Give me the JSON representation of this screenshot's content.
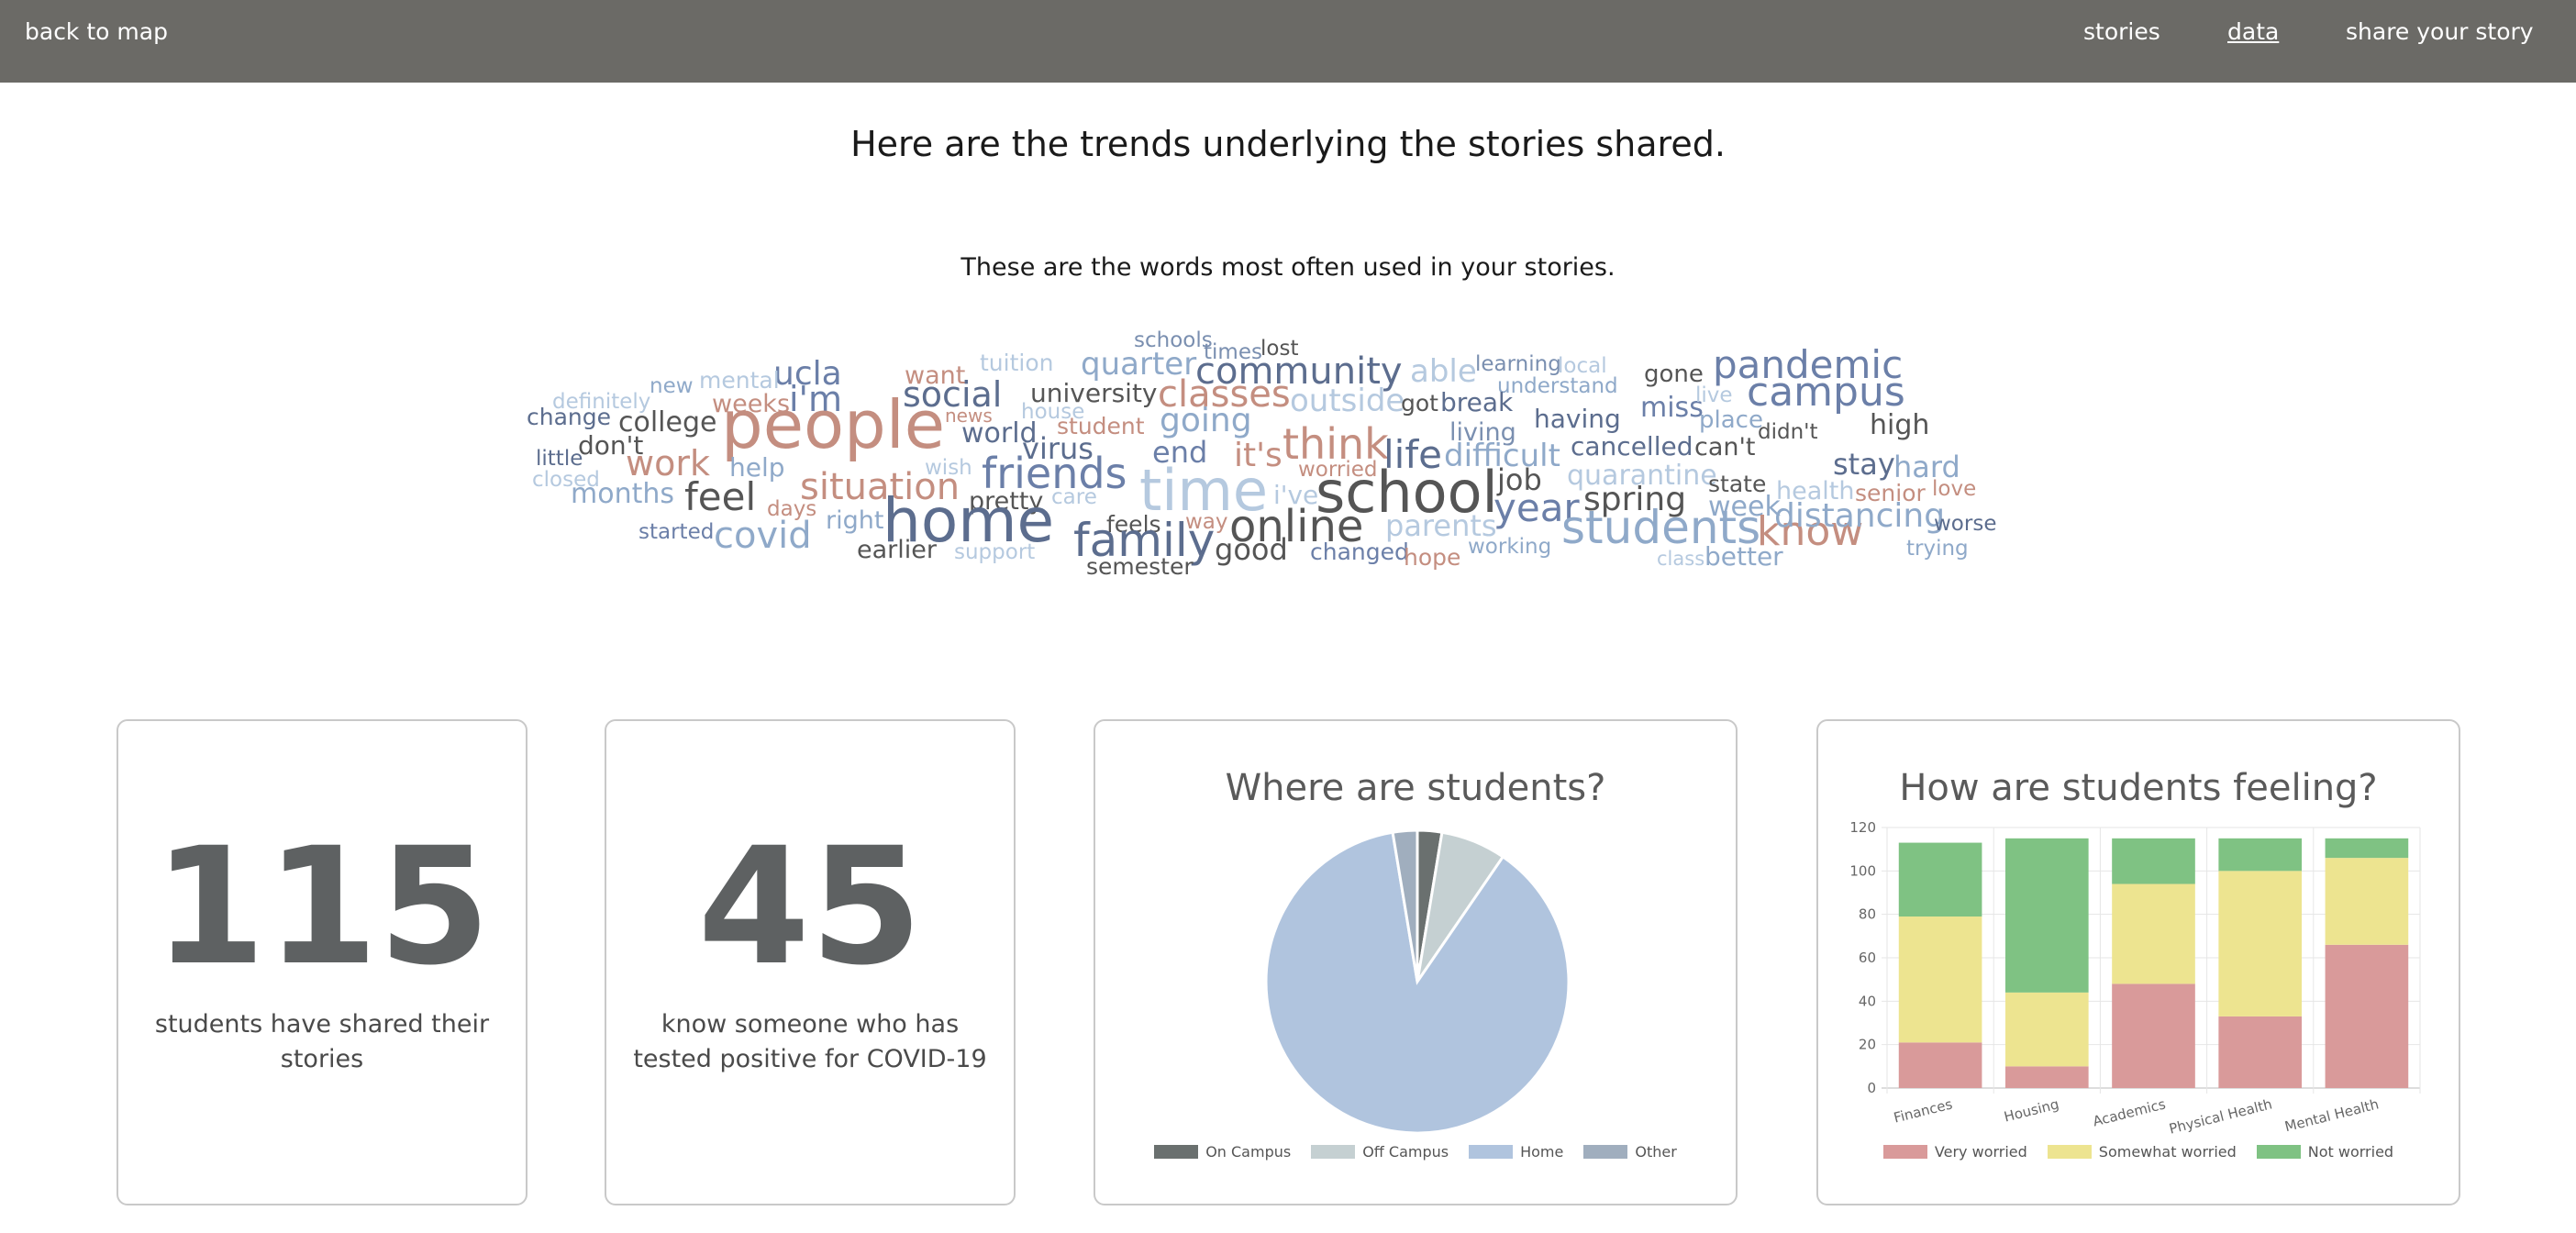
{
  "nav": {
    "back": "back to map",
    "stories": "stories",
    "data": "data",
    "share": "share your story"
  },
  "headline": "Here are the trends underlying the stories shared.",
  "wordcloud": {
    "subtitle": "These are the words most often used in your stories.",
    "words": [
      [
        "schools",
        1236,
        378,
        23,
        "#7a8fb0"
      ],
      [
        "times",
        1312,
        391,
        23,
        "#7a8fb0"
      ],
      [
        "lost",
        1374,
        387,
        23,
        "#555"
      ],
      [
        "ucla",
        843,
        419,
        36,
        "#6b7fa8"
      ],
      [
        "tuition",
        1068,
        404,
        25,
        "#b5c9df"
      ],
      [
        "quarter",
        1178,
        408,
        34,
        "#8fa9c9"
      ],
      [
        "community",
        1303,
        418,
        40,
        "#5c6d8e"
      ],
      [
        "able",
        1537,
        416,
        34,
        "#b5c9df"
      ],
      [
        "learning",
        1608,
        404,
        23,
        "#7a8fb0"
      ],
      [
        "local",
        1698,
        406,
        23,
        "#b5c9df"
      ],
      [
        "gone",
        1792,
        416,
        26,
        "#555"
      ],
      [
        "pandemic",
        1867,
        412,
        42,
        "#6b7fa8"
      ],
      [
        "new",
        708,
        428,
        23,
        "#8fa9c9"
      ],
      [
        "mental",
        762,
        423,
        25,
        "#b5c9df"
      ],
      [
        "want",
        986,
        418,
        27,
        "#c48e80"
      ],
      [
        "understand",
        1632,
        428,
        23,
        "#8fa9c9"
      ],
      [
        "definitely",
        602,
        445,
        23,
        "#b5c9df"
      ],
      [
        "weeks",
        776,
        449,
        27,
        "#c48e80"
      ],
      [
        "i'm",
        860,
        448,
        38,
        "#6b7fa8"
      ],
      [
        "social",
        984,
        443,
        38,
        "#5c6d8e"
      ],
      [
        "university",
        1123,
        438,
        28,
        "#555"
      ],
      [
        "classes",
        1262,
        443,
        40,
        "#c48e80"
      ],
      [
        "outside",
        1406,
        448,
        34,
        "#b5c9df"
      ],
      [
        "got",
        1527,
        448,
        25,
        "#555"
      ],
      [
        "break",
        1570,
        448,
        28,
        "#5c6d8e"
      ],
      [
        "miss",
        1788,
        454,
        30,
        "#6b7fa8"
      ],
      [
        "live",
        1848,
        438,
        23,
        "#b5c9df"
      ],
      [
        "campus",
        1904,
        442,
        44,
        "#6b7fa8"
      ],
      [
        "change",
        574,
        463,
        25,
        "#5c6d8e"
      ],
      [
        "college",
        674,
        470,
        30,
        "#555"
      ],
      [
        "people",
        786,
        488,
        72,
        "#c48e80"
      ],
      [
        "news",
        1030,
        460,
        20,
        "#c48e80"
      ],
      [
        "house",
        1113,
        456,
        23,
        "#b5c9df"
      ],
      [
        "going",
        1264,
        470,
        36,
        "#8fa9c9"
      ],
      [
        "student",
        1152,
        473,
        25,
        "#c48e80"
      ],
      [
        "world",
        1048,
        482,
        30,
        "#5c6d8e"
      ],
      [
        "living",
        1580,
        480,
        27,
        "#7a8fb0"
      ],
      [
        "having",
        1672,
        466,
        28,
        "#5c6d8e"
      ],
      [
        "place",
        1852,
        466,
        26,
        "#8fa9c9"
      ],
      [
        "didn't",
        1916,
        478,
        23,
        "#555"
      ],
      [
        "high",
        2038,
        473,
        30,
        "#555"
      ],
      [
        "don't",
        630,
        495,
        28,
        "#555"
      ],
      [
        "little",
        584,
        507,
        23,
        "#5c6d8e"
      ],
      [
        "virus",
        1114,
        500,
        32,
        "#5c6d8e"
      ],
      [
        "end",
        1256,
        504,
        32,
        "#6b7fa8"
      ],
      [
        "it's",
        1345,
        508,
        36,
        "#c48e80"
      ],
      [
        "think",
        1398,
        500,
        46,
        "#c48e80"
      ],
      [
        "life",
        1508,
        510,
        42,
        "#5c6d8e"
      ],
      [
        "difficult",
        1574,
        508,
        34,
        "#8fa9c9"
      ],
      [
        "cancelled",
        1712,
        496,
        28,
        "#5c6d8e"
      ],
      [
        "can't",
        1847,
        496,
        27,
        "#555"
      ],
      [
        "work",
        682,
        518,
        38,
        "#c48e80"
      ],
      [
        "help",
        795,
        519,
        28,
        "#8fa9c9"
      ],
      [
        "wish",
        1008,
        517,
        23,
        "#b5c9df"
      ],
      [
        "friends",
        1070,
        532,
        46,
        "#6b7fa8"
      ],
      [
        "worried",
        1415,
        519,
        23,
        "#c48e80"
      ],
      [
        "stay",
        1998,
        517,
        32,
        "#5c6d8e"
      ],
      [
        "hard",
        2064,
        520,
        32,
        "#8fa9c9"
      ],
      [
        "closed",
        580,
        530,
        23,
        "#b5c9df"
      ],
      [
        "situation",
        872,
        544,
        40,
        "#c48e80"
      ],
      [
        "job",
        1632,
        534,
        32,
        "#555"
      ],
      [
        "quarantine",
        1708,
        528,
        30,
        "#b5c9df"
      ],
      [
        "state",
        1862,
        536,
        25,
        "#555"
      ],
      [
        "love",
        2106,
        540,
        23,
        "#c48e80"
      ],
      [
        "months",
        622,
        548,
        30,
        "#8fa9c9"
      ],
      [
        "feel",
        746,
        556,
        42,
        "#555"
      ],
      [
        "time",
        1242,
        556,
        62,
        "#b5c9df"
      ],
      [
        "care",
        1146,
        549,
        23,
        "#b5c9df"
      ],
      [
        "i've",
        1388,
        549,
        28,
        "#b5c9df"
      ],
      [
        "school",
        1434,
        558,
        62,
        "#555"
      ],
      [
        "spring",
        1726,
        556,
        36,
        "#555"
      ],
      [
        "health",
        1936,
        544,
        27,
        "#b5c9df"
      ],
      [
        "senior",
        2022,
        546,
        25,
        "#c48e80"
      ],
      [
        "days",
        836,
        562,
        23,
        "#c48e80"
      ],
      [
        "pretty",
        1056,
        555,
        27,
        "#555"
      ],
      [
        "year",
        1628,
        568,
        42,
        "#6b7fa8"
      ],
      [
        "week",
        1862,
        562,
        30,
        "#8fa9c9"
      ],
      [
        "right",
        900,
        576,
        27,
        "#8fa9c9"
      ],
      [
        "home",
        962,
        590,
        66,
        "#5c6d8e"
      ],
      [
        "way",
        1292,
        576,
        23,
        "#c48e80"
      ],
      [
        "feels",
        1206,
        580,
        25,
        "#555"
      ],
      [
        "online",
        1340,
        590,
        48,
        "#555"
      ],
      [
        "parents",
        1510,
        584,
        32,
        "#b5c9df"
      ],
      [
        "students",
        1702,
        592,
        50,
        "#8fa9c9"
      ],
      [
        "know",
        1915,
        594,
        44,
        "#c48e80"
      ],
      [
        "distancing",
        1934,
        574,
        36,
        "#8fa9c9"
      ],
      [
        "worse",
        2108,
        578,
        23,
        "#5c6d8e"
      ],
      [
        "started",
        696,
        587,
        23,
        "#6b7fa8"
      ],
      [
        "covid",
        778,
        597,
        40,
        "#8fa9c9"
      ],
      [
        "family",
        1170,
        606,
        50,
        "#5c6d8e"
      ],
      [
        "working",
        1600,
        603,
        23,
        "#8fa9c9"
      ],
      [
        "trying",
        2078,
        605,
        23,
        "#8fa9c9"
      ],
      [
        "earlier",
        934,
        608,
        27,
        "#555"
      ],
      [
        "support",
        1040,
        609,
        23,
        "#b5c9df"
      ],
      [
        "good",
        1324,
        610,
        32,
        "#555"
      ],
      [
        "changed",
        1428,
        610,
        25,
        "#6b7fa8"
      ],
      [
        "hope",
        1530,
        616,
        25,
        "#c48e80"
      ],
      [
        "class",
        1806,
        616,
        21,
        "#b5c9df"
      ],
      [
        "better",
        1858,
        616,
        28,
        "#8fa9c9"
      ],
      [
        "semester",
        1184,
        626,
        25,
        "#555"
      ]
    ]
  },
  "stats": [
    {
      "value": "115",
      "label": "students have shared their stories"
    },
    {
      "value": "45",
      "label": "know someone who has tested positive for COVID-19"
    }
  ],
  "pie_chart": {
    "title": "Where are students?",
    "chart_data": {
      "type": "pie",
      "labels": [
        "On Campus",
        "Off Campus",
        "Home",
        "Other"
      ],
      "values": [
        3,
        8,
        101,
        3
      ],
      "colors": [
        "#6a706f",
        "#c5d0d2",
        "#b0c4de",
        "#a0aebe"
      ]
    }
  },
  "bar_chart": {
    "title": "How are students feeling?",
    "chart_data": {
      "type": "bar",
      "stacked": true,
      "categories": [
        "Finances",
        "Housing",
        "Academics",
        "Physical Health",
        "Mental Health"
      ],
      "series": [
        {
          "name": "Very worried",
          "values": [
            21,
            10,
            48,
            33,
            66
          ],
          "color": "#d99a9a"
        },
        {
          "name": "Somewhat worried",
          "values": [
            58,
            34,
            46,
            67,
            40
          ],
          "color": "#ede490"
        },
        {
          "name": "Not worried",
          "values": [
            34,
            71,
            21,
            15,
            9
          ],
          "color": "#7fc283"
        }
      ],
      "ylim": [
        0,
        120
      ],
      "yticks": [
        0,
        20,
        40,
        60,
        80,
        100,
        120
      ],
      "grid": true,
      "legend": "bottom"
    }
  }
}
